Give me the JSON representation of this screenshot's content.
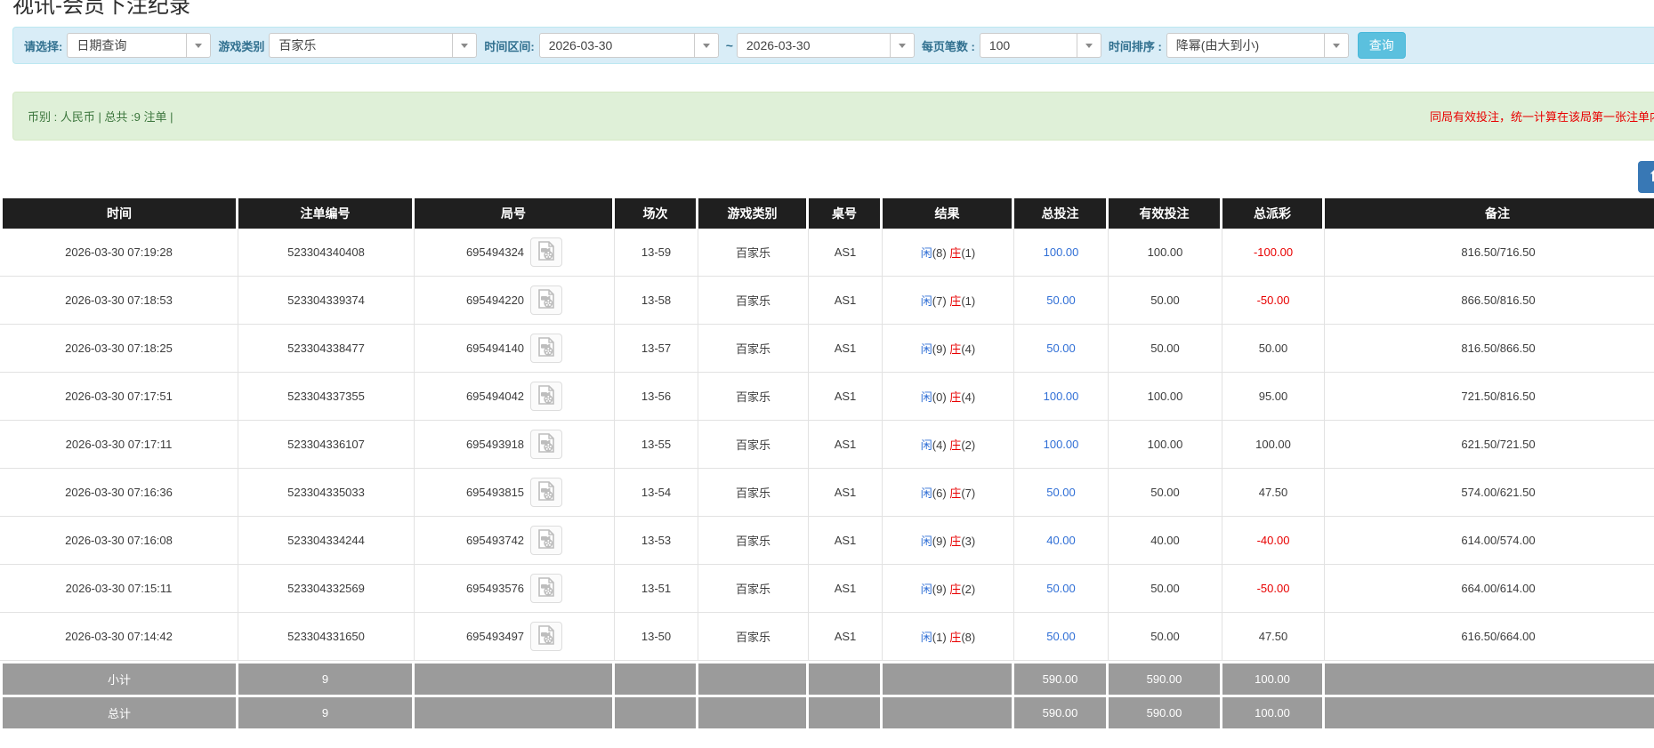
{
  "page": {
    "title": "视讯-会员下注纪录"
  },
  "filters": {
    "select_label": "请选择:",
    "select_value": "日期查询",
    "game_type_label": "游戏类别",
    "game_type_value": "百家乐",
    "date_range_label": "时间区间:",
    "date_from": "2026-03-30",
    "date_separator": "~",
    "date_to": "2026-03-30",
    "page_size_label": "每页笔数 :",
    "page_size_value": "100",
    "sort_label": "时间排序 :",
    "sort_value": "降幂(由大到小)",
    "search_button_label": "查询"
  },
  "summary_bar": {
    "left_text": "币别 : 人民币 | 总共 :9 注单 |",
    "right_notice": "同局有效投注，统一计算在该局第一张注单内"
  },
  "icons": {
    "video_record": "film-document-icon",
    "dropdown": "caret-down-icon",
    "scroll_top": "arrow-up-icon"
  },
  "colors": {
    "accent_blue": "#306fd6",
    "negative_red": "#e80000",
    "header_bg": "#1f1f1f",
    "summary_row_bg": "#9b9b9b",
    "filter_panel_bg": "#d9edf7",
    "summary_panel_bg": "#dff0d8",
    "search_button_bg": "#5bc0de",
    "green_text": "#3c763d"
  },
  "table": {
    "headers": [
      {
        "key": "time",
        "label": "时间"
      },
      {
        "key": "bet_id",
        "label": "注单编号"
      },
      {
        "key": "round_id",
        "label": "局号"
      },
      {
        "key": "session",
        "label": "场次"
      },
      {
        "key": "game",
        "label": "游戏类别"
      },
      {
        "key": "table_no",
        "label": "桌号"
      },
      {
        "key": "result",
        "label": "结果"
      },
      {
        "key": "total_bet",
        "label": "总投注"
      },
      {
        "key": "valid_bet",
        "label": "有效投注"
      },
      {
        "key": "payout",
        "label": "总派彩"
      },
      {
        "key": "remark",
        "label": "备注"
      }
    ],
    "rows": [
      {
        "time": "2026-03-30 07:19:28",
        "bet_id": "523304340408",
        "round_id": "695494324",
        "session": "13-59",
        "game": "百家乐",
        "table_no": "AS1",
        "result": {
          "player": "闲",
          "player_score": "(8)",
          "banker": "庄",
          "banker_score": "(1)"
        },
        "total_bet": "100.00",
        "valid_bet": "100.00",
        "payout": "-100.00",
        "payout_negative": true,
        "remark": "816.50/716.50"
      },
      {
        "time": "2026-03-30 07:18:53",
        "bet_id": "523304339374",
        "round_id": "695494220",
        "session": "13-58",
        "game": "百家乐",
        "table_no": "AS1",
        "result": {
          "player": "闲",
          "player_score": "(7)",
          "banker": "庄",
          "banker_score": "(1)"
        },
        "total_bet": "50.00",
        "valid_bet": "50.00",
        "payout": "-50.00",
        "payout_negative": true,
        "remark": "866.50/816.50"
      },
      {
        "time": "2026-03-30 07:18:25",
        "bet_id": "523304338477",
        "round_id": "695494140",
        "session": "13-57",
        "game": "百家乐",
        "table_no": "AS1",
        "result": {
          "player": "闲",
          "player_score": "(9)",
          "banker": "庄",
          "banker_score": "(4)"
        },
        "total_bet": "50.00",
        "valid_bet": "50.00",
        "payout": "50.00",
        "payout_negative": false,
        "remark": "816.50/866.50"
      },
      {
        "time": "2026-03-30 07:17:51",
        "bet_id": "523304337355",
        "round_id": "695494042",
        "session": "13-56",
        "game": "百家乐",
        "table_no": "AS1",
        "result": {
          "player": "闲",
          "player_score": "(0)",
          "banker": "庄",
          "banker_score": "(4)"
        },
        "total_bet": "100.00",
        "valid_bet": "100.00",
        "payout": "95.00",
        "payout_negative": false,
        "remark": "721.50/816.50"
      },
      {
        "time": "2026-03-30 07:17:11",
        "bet_id": "523304336107",
        "round_id": "695493918",
        "session": "13-55",
        "game": "百家乐",
        "table_no": "AS1",
        "result": {
          "player": "闲",
          "player_score": "(4)",
          "banker": "庄",
          "banker_score": "(2)"
        },
        "total_bet": "100.00",
        "valid_bet": "100.00",
        "payout": "100.00",
        "payout_negative": false,
        "remark": "621.50/721.50"
      },
      {
        "time": "2026-03-30 07:16:36",
        "bet_id": "523304335033",
        "round_id": "695493815",
        "session": "13-54",
        "game": "百家乐",
        "table_no": "AS1",
        "result": {
          "player": "闲",
          "player_score": "(6)",
          "banker": "庄",
          "banker_score": "(7)"
        },
        "total_bet": "50.00",
        "valid_bet": "50.00",
        "payout": "47.50",
        "payout_negative": false,
        "remark": "574.00/621.50"
      },
      {
        "time": "2026-03-30 07:16:08",
        "bet_id": "523304334244",
        "round_id": "695493742",
        "session": "13-53",
        "game": "百家乐",
        "table_no": "AS1",
        "result": {
          "player": "闲",
          "player_score": "(9)",
          "banker": "庄",
          "banker_score": "(3)"
        },
        "total_bet": "40.00",
        "valid_bet": "40.00",
        "payout": "-40.00",
        "payout_negative": true,
        "remark": "614.00/574.00"
      },
      {
        "time": "2026-03-30 07:15:11",
        "bet_id": "523304332569",
        "round_id": "695493576",
        "session": "13-51",
        "game": "百家乐",
        "table_no": "AS1",
        "result": {
          "player": "闲",
          "player_score": "(9)",
          "banker": "庄",
          "banker_score": "(2)"
        },
        "total_bet": "50.00",
        "valid_bet": "50.00",
        "payout": "-50.00",
        "payout_negative": true,
        "remark": "664.00/614.00"
      },
      {
        "time": "2026-03-30 07:14:42",
        "bet_id": "523304331650",
        "round_id": "695493497",
        "session": "13-50",
        "game": "百家乐",
        "table_no": "AS1",
        "result": {
          "player": "闲",
          "player_score": "(1)",
          "banker": "庄",
          "banker_score": "(8)"
        },
        "total_bet": "50.00",
        "valid_bet": "50.00",
        "payout": "47.50",
        "payout_negative": false,
        "remark": "616.50/664.00"
      }
    ],
    "summary_rows": [
      {
        "label": "小计",
        "count": "9",
        "total_bet": "590.00",
        "valid_bet": "590.00",
        "payout": "100.00"
      },
      {
        "label": "总计",
        "count": "9",
        "total_bet": "590.00",
        "valid_bet": "590.00",
        "payout": "100.00"
      }
    ]
  }
}
